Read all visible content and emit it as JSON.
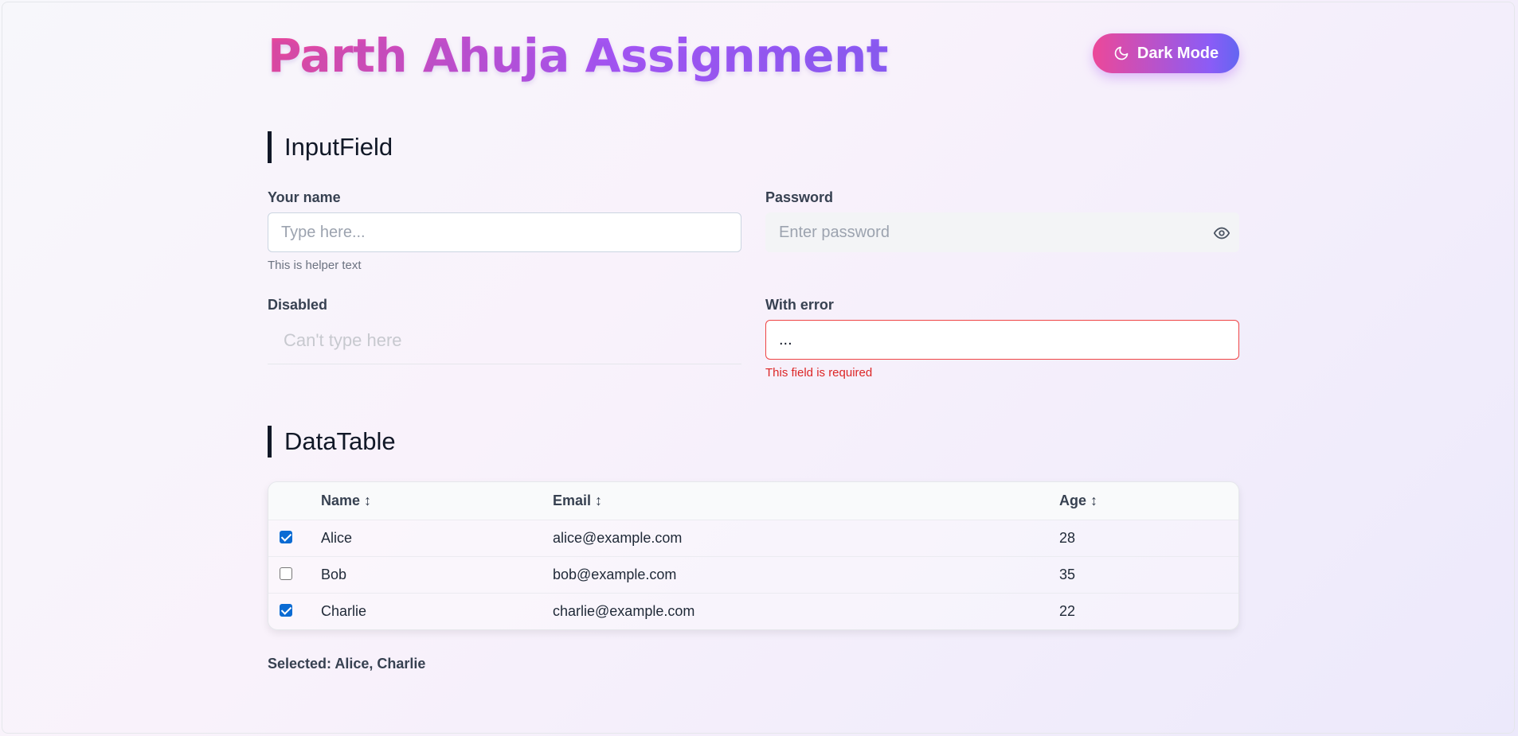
{
  "header": {
    "title": "Parth Ahuja Assignment",
    "theme_button_label": "Dark Mode",
    "theme_button_icon": "moon-icon"
  },
  "input_section": {
    "title": "InputField",
    "fields": [
      {
        "label": "Your name",
        "placeholder": "Type here...",
        "helper": "This is helper text",
        "variant": "outlined"
      },
      {
        "label": "Password",
        "placeholder": "Enter password",
        "variant": "filled",
        "icon": "eye-icon"
      },
      {
        "label": "Disabled",
        "placeholder": "Can't type here",
        "variant": "ghost",
        "disabled": true
      },
      {
        "label": "With error",
        "value": "...",
        "error": "This field is required",
        "variant": "outlined-error"
      }
    ]
  },
  "table_section": {
    "title": "DataTable",
    "columns": [
      "Name",
      "Email",
      "Age"
    ],
    "sort_glyph": "↕",
    "rows": [
      {
        "selected": true,
        "name": "Alice",
        "email": "alice@example.com",
        "age": "28"
      },
      {
        "selected": false,
        "name": "Bob",
        "email": "bob@example.com",
        "age": "35"
      },
      {
        "selected": true,
        "name": "Charlie",
        "email": "charlie@example.com",
        "age": "22"
      }
    ],
    "selected_summary": "Selected: Alice, Charlie"
  },
  "colors": {
    "accent_pink": "#ec4899",
    "accent_purple": "#8b5cf6",
    "error": "#ef4444",
    "checkbox": "#0b6bd3"
  }
}
